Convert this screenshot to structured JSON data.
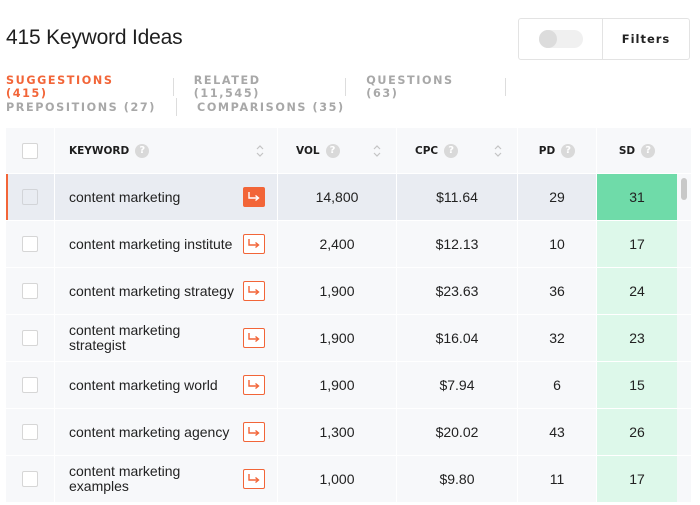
{
  "header": {
    "title": "415 Keyword Ideas"
  },
  "controls": {
    "filters_label": "Filters",
    "toggle_on": false
  },
  "tabs": {
    "row1": [
      {
        "label": "SUGGESTIONS (415)",
        "active": true
      },
      {
        "label": "RELATED (11,545)",
        "active": false
      },
      {
        "label": "QUESTIONS (63)",
        "active": false
      }
    ],
    "row2": [
      {
        "label": "PREPOSITIONS (27)",
        "active": false
      },
      {
        "label": "COMPARISONS (35)",
        "active": false
      }
    ]
  },
  "table": {
    "columns": {
      "keyword": "KEYWORD",
      "vol": "VOL",
      "cpc": "CPC",
      "pd": "PD",
      "sd": "SD"
    },
    "help_glyph": "?",
    "rows": [
      {
        "keyword": "content marketing",
        "vol": "14,800",
        "cpc": "$11.64",
        "pd": "29",
        "sd": "31"
      },
      {
        "keyword": "content marketing institute",
        "vol": "2,400",
        "cpc": "$12.13",
        "pd": "10",
        "sd": "17"
      },
      {
        "keyword": "content marketing strategy",
        "vol": "1,900",
        "cpc": "$23.63",
        "pd": "36",
        "sd": "24"
      },
      {
        "keyword": "content marketing strategist",
        "vol": "1,900",
        "cpc": "$16.04",
        "pd": "32",
        "sd": "23"
      },
      {
        "keyword": "content marketing world",
        "vol": "1,900",
        "cpc": "$7.94",
        "pd": "6",
        "sd": "15"
      },
      {
        "keyword": "content marketing agency",
        "vol": "1,300",
        "cpc": "$20.02",
        "pd": "43",
        "sd": "26"
      },
      {
        "keyword": "content marketing examples",
        "vol": "1,000",
        "cpc": "$9.80",
        "pd": "11",
        "sd": "17"
      }
    ]
  },
  "colors": {
    "accent": "#f26538",
    "sd_light": "#ddf8ea",
    "sd_strong": "#6fdba9"
  },
  "icons": {
    "arrow": "arrow-into-icon",
    "help": "help-circle-icon",
    "sort": "sort-chevrons-icon"
  }
}
